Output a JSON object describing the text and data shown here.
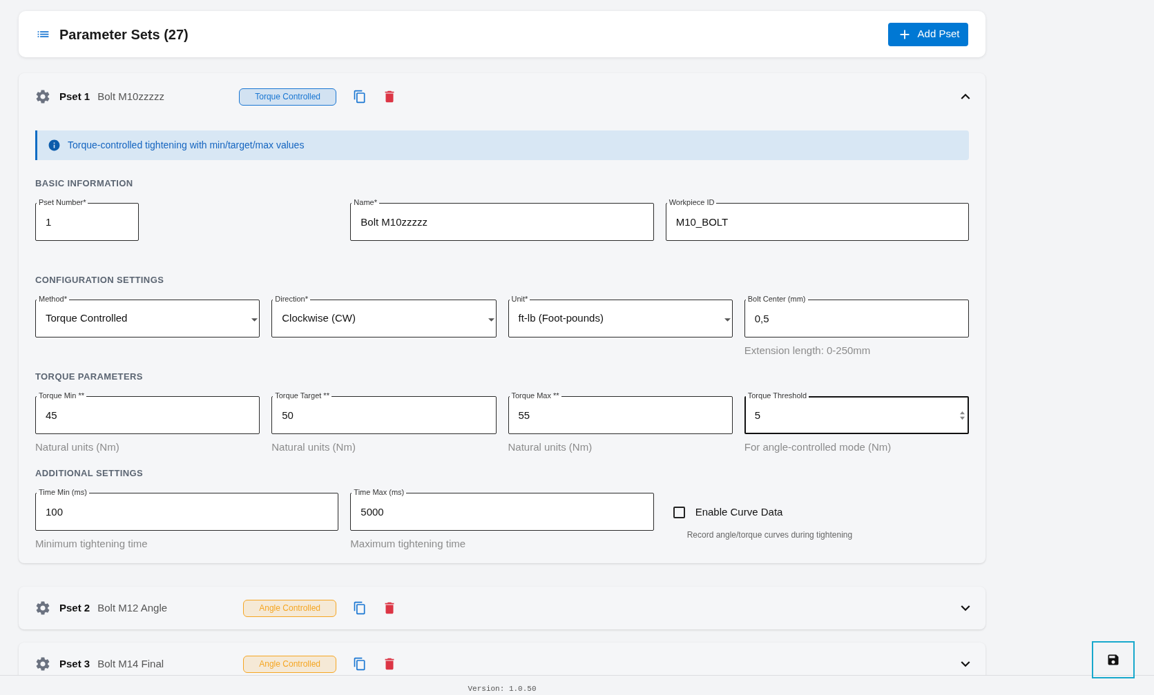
{
  "header": {
    "title": "Parameter Sets (27)",
    "add_button": "Add Pset"
  },
  "psets": [
    {
      "title": "Pset 1",
      "name": "Bolt M10zzzzz",
      "badge": {
        "label": "Torque Controlled",
        "color": "#1976d2"
      },
      "expanded": true,
      "info": "Torque-controlled tightening with min/target/max values",
      "sections": [
        {
          "heading": "BASIC INFORMATION",
          "fields": [
            {
              "kind": "compact",
              "label": "Pset Number*",
              "value": "1",
              "focused": false
            },
            {
              "kind": "text",
              "label": "Name*",
              "value": "Bolt M10zzzzz",
              "focused": false
            },
            {
              "kind": "text",
              "label": "Workpiece ID",
              "value": "M10_BOLT",
              "focused": false
            }
          ]
        },
        {
          "heading": "CONFIGURATION SETTINGS",
          "fields": [
            {
              "kind": "select",
              "label": "Method*",
              "value": "Torque Controlled",
              "focused": false
            },
            {
              "kind": "select",
              "label": "Direction*",
              "value": "Clockwise (CW)",
              "focused": false
            },
            {
              "kind": "select",
              "label": "Unit*",
              "value": "ft-lb (Foot-pounds)",
              "focused": false
            },
            {
              "kind": "text",
              "label": "Bolt Center (mm)",
              "value": "0,5",
              "helper": "Extension length: 0-250mm",
              "focused": false
            }
          ]
        },
        {
          "heading": "TORQUE PARAMETERS",
          "fields": [
            {
              "kind": "text",
              "label": "Torque Min **",
              "value": "45",
              "helper": "Natural units (Nm)",
              "focused": false
            },
            {
              "kind": "text",
              "label": "Torque Target **",
              "value": "50",
              "helper": "Natural units (Nm)",
              "focused": false
            },
            {
              "kind": "text",
              "label": "Torque Max **",
              "value": "55",
              "helper": "Natural units (Nm)",
              "focused": false
            },
            {
              "kind": "text",
              "label": "Torque Threshold",
              "value": "5",
              "helper": "For angle-controlled mode (Nm)",
              "focused": true
            }
          ]
        },
        {
          "heading": "ADDITIONAL SETTINGS",
          "fields": [
            {
              "kind": "text",
              "label": "Time Min (ms)",
              "value": "100",
              "helper": "Minimum tightening time",
              "focused": false
            },
            {
              "kind": "text",
              "label": "Time Max (ms)",
              "value": "5000",
              "helper": "Maximum tightening time",
              "focused": false
            },
            {
              "kind": "checkbox",
              "label": "Enable Curve Data",
              "checked": false,
              "helper": "Record angle/torque curves during tightening"
            }
          ]
        }
      ]
    },
    {
      "title": "Pset 2",
      "name": "Bolt M12 Angle",
      "badge": {
        "label": "Angle Controlled",
        "color": "#f5a623"
      },
      "expanded": false
    },
    {
      "title": "Pset 3",
      "name": "Bolt M14 Final",
      "badge": {
        "label": "Angle Controlled",
        "color": "#f5a623"
      },
      "expanded": false
    }
  ],
  "footer": {
    "version": "Version: 1.0.50"
  }
}
